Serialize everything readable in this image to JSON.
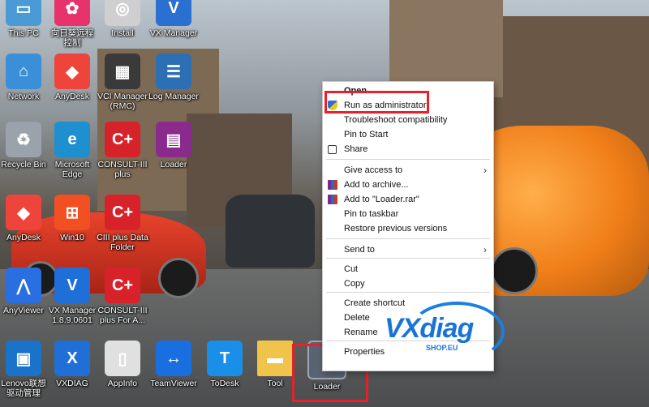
{
  "desktop_icons": [
    {
      "label": "This PC",
      "icon": "computer-icon",
      "color": "#4a9ad6"
    },
    {
      "label": "向日葵远程\n控制",
      "icon": "sunflower-icon",
      "color": "#e8326b"
    },
    {
      "label": "Install",
      "icon": "disc-icon",
      "color": "#cfcfcf"
    },
    {
      "label": "VX Manager",
      "icon": "vx-icon",
      "color": "#2b6fd0"
    },
    {
      "label": "Network",
      "icon": "network-icon",
      "color": "#3b8fd8"
    },
    {
      "label": "AnyDesk",
      "icon": "anydesk-icon",
      "color": "#ef443b"
    },
    {
      "label": "VCI Manager\n(RMC)",
      "icon": "vci-icon",
      "color": "#3a3a3a"
    },
    {
      "label": "Log Manager",
      "icon": "log-icon",
      "color": "#2d6fb5"
    },
    {
      "label": "Recycle Bin",
      "icon": "recycle-bin-icon",
      "color": "#9aa3ab"
    },
    {
      "label": "Microsoft\nEdge",
      "icon": "edge-icon",
      "color": "#1e8fcf"
    },
    {
      "label": "CONSULT-III\nplus",
      "icon": "consult-icon",
      "color": "#d8222a"
    },
    {
      "label": "Loader",
      "icon": "winrar-icon",
      "color": "#8a2a8c"
    },
    {
      "label": "AnyDesk",
      "icon": "anydesk-icon",
      "color": "#ef443b"
    },
    {
      "label": "Win10",
      "icon": "windows-icon",
      "color": "#f25022"
    },
    {
      "label": "CIII plus Data\nFolder",
      "icon": "consult-folder-icon",
      "color": "#d8222a"
    },
    {
      "label": "AnyViewer",
      "icon": "anyviewer-icon",
      "color": "#2a6fe0"
    },
    {
      "label": "VX Manager\n1.8.9.0601",
      "icon": "vx-icon",
      "color": "#1e6fd8"
    },
    {
      "label": "CONSULT-III\nplus For A...",
      "icon": "consult-icon",
      "color": "#d8222a"
    },
    {
      "label": "Lenovo联想\n驱动管理",
      "icon": "lenovo-icon",
      "color": "#1a73c8"
    },
    {
      "label": "VXDIAG",
      "icon": "vxdiag-icon",
      "color": "#1f6fd6"
    },
    {
      "label": "AppInfo",
      "icon": "appinfo-icon",
      "color": "#e0e0e0"
    },
    {
      "label": "TeamViewer",
      "icon": "teamviewer-icon",
      "color": "#1a6fe0"
    },
    {
      "label": "ToDesk",
      "icon": "todesk-icon",
      "color": "#1a8fe8"
    },
    {
      "label": "Tool",
      "icon": "folder-icon",
      "color": "#f0c34a"
    },
    {
      "label": "Loader",
      "icon": "nissan-loader-icon",
      "color": "#5a6470"
    }
  ],
  "context_menu": {
    "items": [
      {
        "label": "Open",
        "icon": ""
      },
      {
        "label": "Run as administrator",
        "icon": "shield-icon"
      },
      {
        "label": "Troubleshoot compatibility",
        "icon": ""
      },
      {
        "label": "Pin to Start",
        "icon": ""
      },
      {
        "label": "Share",
        "icon": "share-icon"
      },
      {
        "label": "Give access to",
        "icon": "",
        "submenu": true
      },
      {
        "label": "Add to archive...",
        "icon": "winrar-icon"
      },
      {
        "label": "Add to \"Loader.rar\"",
        "icon": "winrar-icon"
      },
      {
        "label": "Pin to taskbar",
        "icon": ""
      },
      {
        "label": "Restore previous versions",
        "icon": ""
      },
      {
        "label": "Send to",
        "icon": "",
        "submenu": true
      },
      {
        "label": "Cut",
        "icon": ""
      },
      {
        "label": "Copy",
        "icon": ""
      },
      {
        "label": "Create shortcut",
        "icon": ""
      },
      {
        "label": "Delete",
        "icon": ""
      },
      {
        "label": "Rename",
        "icon": ""
      },
      {
        "label": "Properties",
        "icon": ""
      }
    ],
    "submenu_arrow": "›"
  },
  "watermark": {
    "brand": "VXdiag",
    "domain": "SHOP.EU"
  },
  "colors": {
    "highlight": "#e8202a",
    "brand_blue": "#1a73d8"
  }
}
